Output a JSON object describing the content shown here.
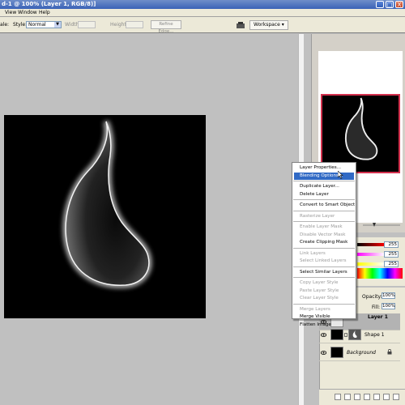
{
  "window": {
    "title": "d-1 @ 100% (Layer 1, RGB/8)]",
    "minimize": "_",
    "maximize": "□",
    "close": "X"
  },
  "menu": {
    "items": [
      "View",
      "Window",
      "Help"
    ]
  },
  "options": {
    "style_prefix": "ale:",
    "style_label": "Style:",
    "style_value": "Normal",
    "width_label": "Width:",
    "height_label": "Height:",
    "refine_edge": "Refine Edge...",
    "workspace": "Workspace ▾"
  },
  "context_menu": {
    "groups": [
      [
        {
          "label": "Layer Properties...",
          "enabled": true,
          "highlighted": false
        },
        {
          "label": "Blending Options...",
          "enabled": true,
          "highlighted": true
        }
      ],
      [
        {
          "label": "Duplicate Layer...",
          "enabled": true,
          "highlighted": false
        },
        {
          "label": "Delete Layer",
          "enabled": true,
          "highlighted": false
        }
      ],
      [
        {
          "label": "Convert to Smart Object",
          "enabled": true,
          "highlighted": false
        }
      ],
      [
        {
          "label": "Rasterize Layer",
          "enabled": false,
          "highlighted": false
        }
      ],
      [
        {
          "label": "Enable Layer Mask",
          "enabled": false,
          "highlighted": false
        },
        {
          "label": "Disable Vector Mask",
          "enabled": false,
          "highlighted": false
        },
        {
          "label": "Create Clipping Mask",
          "enabled": true,
          "highlighted": false
        }
      ],
      [
        {
          "label": "Link Layers",
          "enabled": false,
          "highlighted": false
        },
        {
          "label": "Select Linked Layers",
          "enabled": false,
          "highlighted": false
        }
      ],
      [
        {
          "label": "Select Similar Layers",
          "enabled": true,
          "highlighted": false
        }
      ],
      [
        {
          "label": "Copy Layer Style",
          "enabled": false,
          "highlighted": false
        },
        {
          "label": "Paste Layer Style",
          "enabled": false,
          "highlighted": false
        },
        {
          "label": "Clear Layer Style",
          "enabled": false,
          "highlighted": false
        }
      ],
      [
        {
          "label": "Merge Layers",
          "enabled": false,
          "highlighted": false
        },
        {
          "label": "Merge Visible",
          "enabled": true,
          "highlighted": false
        },
        {
          "label": "Flatten Image",
          "enabled": true,
          "highlighted": false
        }
      ]
    ]
  },
  "color": {
    "r": "255",
    "g": "255",
    "b": "255",
    "colors": {
      "r": "#ff0000",
      "g": "#00ff00",
      "b": "#0000ff"
    }
  },
  "layers": {
    "opacity_label": "Opacity:",
    "opacity_value": "100%",
    "fill_label": "Fill:",
    "fill_value": "100%",
    "items": [
      {
        "name": "Layer 1",
        "selected": true
      },
      {
        "name": "Shape 1",
        "selected": false
      },
      {
        "name": "Background",
        "selected": false
      }
    ]
  },
  "colors": {
    "titlebar": "#3a62b7",
    "menu_highlight": "#316ac5",
    "navigator_frame": "#d3304d"
  }
}
